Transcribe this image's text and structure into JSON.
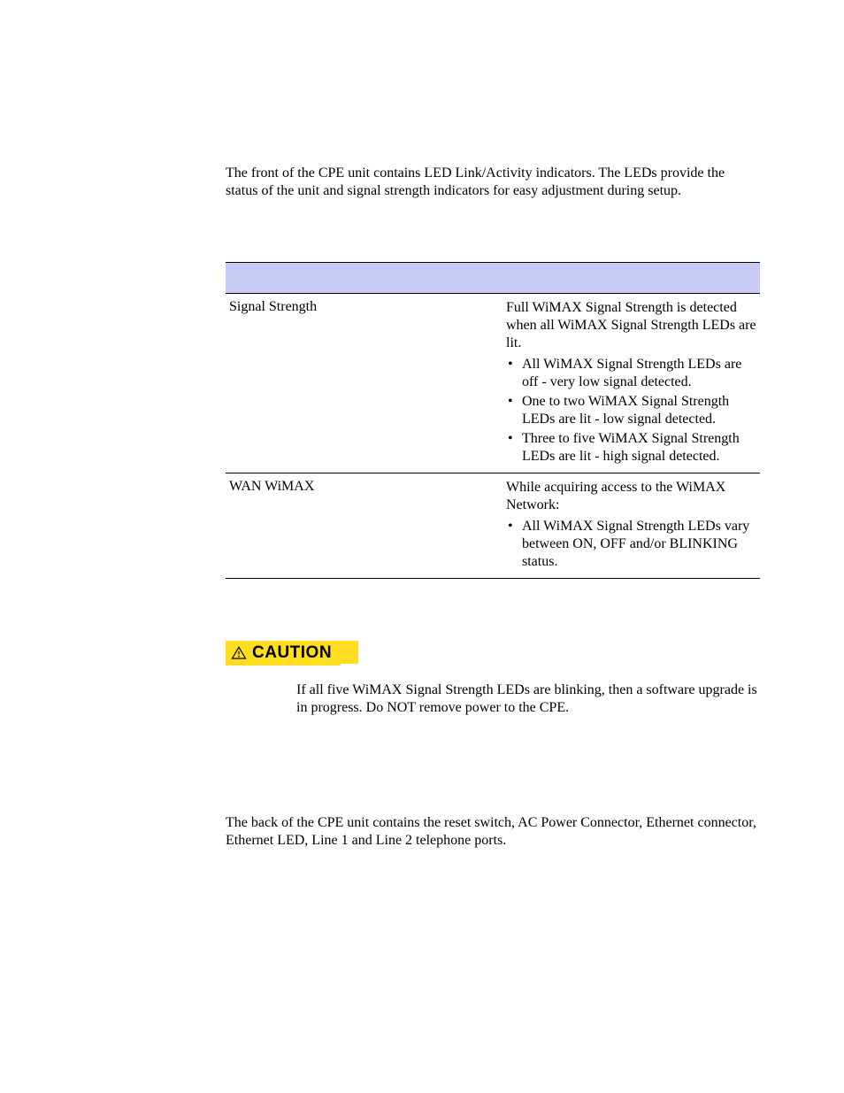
{
  "intro": "The front of the CPE unit contains LED Link/Activity indicators. The LEDs provide the status of the unit and signal strength indicators for easy adjustment during setup.",
  "table": {
    "rows": [
      {
        "label": "Signal Strength",
        "lead": "Full WiMAX Signal Strength is detected when all WiMAX Signal Strength LEDs are lit.",
        "bullets": [
          "All WiMAX Signal Strength LEDs are off - very low signal detected.",
          "One to two WiMAX Signal Strength LEDs are lit - low signal detected.",
          "Three to five WiMAX Signal Strength LEDs are lit - high signal detected."
        ]
      },
      {
        "label": "WAN WiMAX",
        "lead": "While acquiring access to the WiMAX Network:",
        "bullets": [
          "All WiMAX Signal Strength LEDs vary between ON, OFF and/or BLINKING status."
        ]
      }
    ]
  },
  "caution": {
    "label": "CAUTION",
    "body": "If all five WiMAX Signal Strength LEDs are blinking, then a software upgrade is in progress. Do NOT remove power to the CPE."
  },
  "back_intro": "The back of the CPE unit contains the reset switch, AC Power Connector, Ethernet connector, Ethernet LED, Line 1 and Line 2 telephone ports."
}
